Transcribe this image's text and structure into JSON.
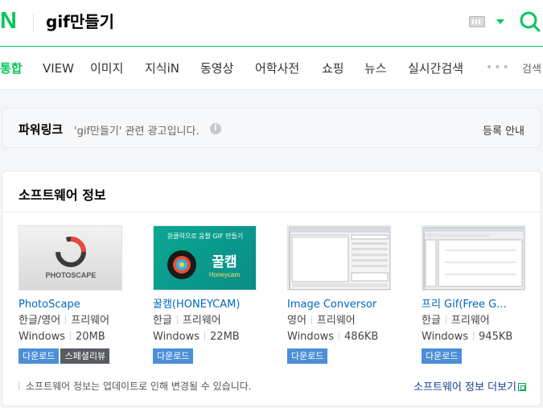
{
  "header": {
    "logo": "N",
    "query": "gif만들기"
  },
  "tabs": [
    {
      "label": "통합",
      "active": true
    },
    {
      "label": "VIEW"
    },
    {
      "label": "이미지"
    },
    {
      "label": "지식iN"
    },
    {
      "label": "동영상"
    },
    {
      "label": "어학사전"
    },
    {
      "label": "쇼핑"
    },
    {
      "label": "뉴스"
    },
    {
      "label": "실시간검색"
    },
    {
      "label": "검색"
    }
  ],
  "more_tabs": "•••",
  "powerlink": {
    "title": "파워링크",
    "subtitle": "'gif만들기' 관련 광고입니다.",
    "info_icon": "i",
    "register": "등록 안내"
  },
  "software": {
    "title": "소프트웨어 정보",
    "items": [
      {
        "name": "PhotoScape",
        "lang": "한글/영어",
        "license": "프리웨어",
        "os": "Windows",
        "size": "20MB",
        "badges": [
          "다운로드",
          "스페셜리뷰"
        ],
        "thumb_text": "PHOTOSCAPE"
      },
      {
        "name": "꿀캠(HONEYCAM)",
        "lang": "한글",
        "license": "프리웨어",
        "os": "Windows",
        "size": "22MB",
        "badges": [
          "다운로드"
        ],
        "thumb_top": "원클릭으로 움짤 GIF 만들기",
        "thumb_title": "꿀캠",
        "thumb_sub": "Honeycam"
      },
      {
        "name": "Image Conversor",
        "lang": "영어",
        "license": "프리웨어",
        "os": "Windows",
        "size": "486KB",
        "badges": [
          "다운로드"
        ]
      },
      {
        "name": "프리 Gif(Free G...",
        "lang": "한글",
        "license": "프리웨어",
        "os": "Windows",
        "size": "945KB",
        "badges": [
          "다운로드"
        ]
      }
    ],
    "note": "소프트웨어 정보는 업데이트로 인해 변경될 수 있습니다.",
    "more_link": "소프트웨어 정보 더보기"
  },
  "colors": {
    "brand": "#03c75a",
    "link": "#0068c3",
    "badge": "#4b8fd8"
  }
}
